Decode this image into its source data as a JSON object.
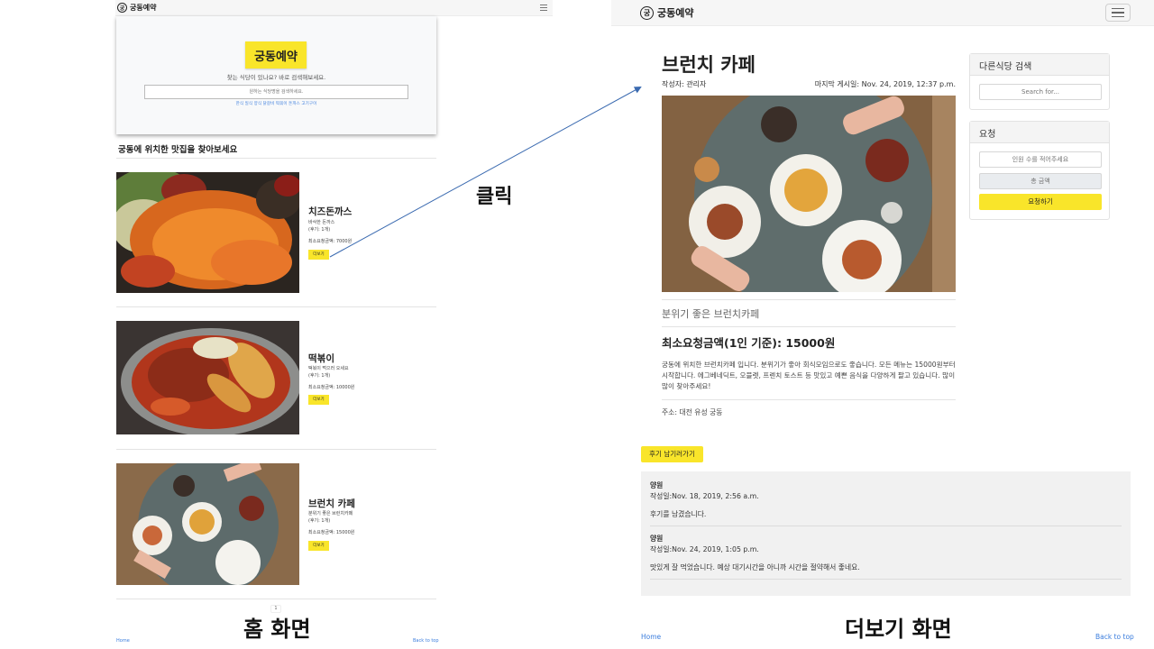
{
  "home": {
    "brand": "궁동예약",
    "hero_title": "궁동예약",
    "hero_sub": "찾는 식당이 있나요? 바로 검색해보세요.",
    "search_placeholder": "원하는 식당명을 검색하세요.",
    "categories": "한식 일식 양식 닭갈비 떡볶이 돈까스 고기구이",
    "heading": "궁동에 위치한 맛집을 찾아보세요",
    "restaurants": [
      {
        "name": "치즈돈까스",
        "desc": "바삭한 돈까스",
        "reviews": "(후기: 1개)",
        "price": "최소요청금액: 7000원",
        "more": "더보기"
      },
      {
        "name": "떡볶이",
        "desc": "떡볶이 먹으러 오세요",
        "reviews": "(후기: 1개)",
        "price": "최소요청금액: 10000원",
        "more": "더보기"
      },
      {
        "name": "브런치 카페",
        "desc": "분위기 좋은 브런치카페",
        "reviews": "(후기: 1개)",
        "price": "최소요청금액: 15000원",
        "more": "더보기"
      }
    ],
    "page": "1",
    "footer_home": "Home",
    "footer_top": "Back to top",
    "caption": "홈 화면"
  },
  "annotation": {
    "click_label": "클릭"
  },
  "detail": {
    "brand": "궁동예약",
    "title": "브런치 카페",
    "author": "작성자: 관리자",
    "last_posted": "마지막 게시일: Nov. 24, 2019, 12:37 p.m.",
    "subtitle": "분위기 좋은 브런치카페",
    "price_heading": "최소요청금액(1인 기준): 15000원",
    "body": "궁동에 위치한 브런치카페 입니다. 분위기가 좋아 회식모임으로도 좋습니다. 모든 메뉴는 15000원부터 시작합니다. 에그베네딕트, 오믈렛, 프렌치 토스트 등 맛있고 예쁜 음식을 다양하게 팔고 있습니다. 많이 많이 찾아주세요!",
    "address": "주소: 대전 유성 궁동",
    "sidebar": {
      "search_title": "다른식당 검색",
      "search_placeholder": "Search for...",
      "request_title": "요청",
      "people_placeholder": "인원 수를 적어주세요",
      "total_placeholder": "총 금액",
      "request_button": "요청하기"
    },
    "review_button": "후기 남기러가기",
    "reviews": [
      {
        "name": "양원",
        "date": "작성일:Nov. 18, 2019, 2:56 a.m.",
        "text": "후기를 남겼습니다."
      },
      {
        "name": "양원",
        "date": "작성일:Nov. 24, 2019, 1:05 p.m.",
        "text": "맛있게 잘 먹었습니다. 예상 대기시간을 아니까 시간을 절약해서 좋네요."
      }
    ],
    "footer_home": "Home",
    "footer_top": "Back to top",
    "caption": "더보기 화면"
  },
  "colors": {
    "accent_yellow": "#f9e52a",
    "link_blue": "#3b7ddd",
    "arrow": "#3a6ab0"
  }
}
